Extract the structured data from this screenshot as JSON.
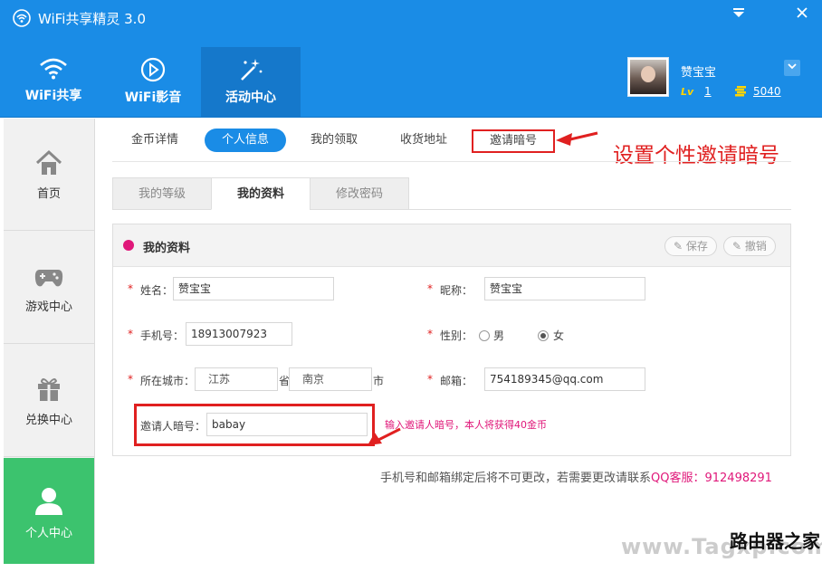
{
  "app": {
    "title": "WiFi共享精灵 3.0"
  },
  "nav": {
    "tabs": [
      {
        "label": "WiFi共享",
        "icon": "wifi-icon"
      },
      {
        "label": "WiFi影音",
        "icon": "play-icon"
      },
      {
        "label": "活动中心",
        "icon": "magic-wand-icon"
      }
    ],
    "active": "活动中心"
  },
  "user": {
    "name": "赞宝宝",
    "level_badge": "Lv",
    "level": "1",
    "coins": "5040"
  },
  "sidebar": {
    "items": [
      {
        "label": "首页",
        "icon": "home-icon"
      },
      {
        "label": "游戏中心",
        "icon": "gamepad-icon"
      },
      {
        "label": "兑换中心",
        "icon": "gift-icon"
      },
      {
        "label": "个人中心",
        "icon": "user-icon"
      }
    ],
    "active": "个人中心"
  },
  "subtabs": [
    "金币详情",
    "个人信息",
    "我的领取",
    "收货地址",
    "邀请暗号"
  ],
  "active_subtab": "个人信息",
  "annotation": "设置个性邀请暗号",
  "inner_tabs": [
    "我的等级",
    "我的资料",
    "修改密码"
  ],
  "active_inner_tab": "我的资料",
  "panel": {
    "title": "我的资料",
    "save_label": "保存",
    "cancel_label": "撤销"
  },
  "form": {
    "name_label": "姓名：",
    "name_value": "赞宝宝",
    "nickname_label": "昵称：",
    "nickname_value": "赞宝宝",
    "phone_label": "手机号：",
    "phone_value": "18913007923",
    "gender_label": "性别：",
    "gender_male": "男",
    "gender_female": "女",
    "gender_selected": "女",
    "city_label": "所在城市：",
    "province_value": "江苏",
    "province_unit": "省",
    "city_value": "南京",
    "city_unit": "市",
    "email_label": "邮箱：",
    "email_value": "754189345@qq.com",
    "invite_label": "邀请人暗号：",
    "invite_value": "babay",
    "invite_hint": "输入邀请人暗号，本人将获得40金币"
  },
  "notice": {
    "text": "手机号和邮箱绑定后将不可更改，若需要更改请联系",
    "qq": "QQ客服：912498291"
  },
  "watermark": {
    "text": "www.Tagxp.com",
    "brand": "路由器之家"
  },
  "colors": {
    "primary": "#1a8ce6",
    "active_sidebar": "#3cc36e",
    "annotation_red": "#e02020",
    "hint_pink": "#e0187a"
  }
}
